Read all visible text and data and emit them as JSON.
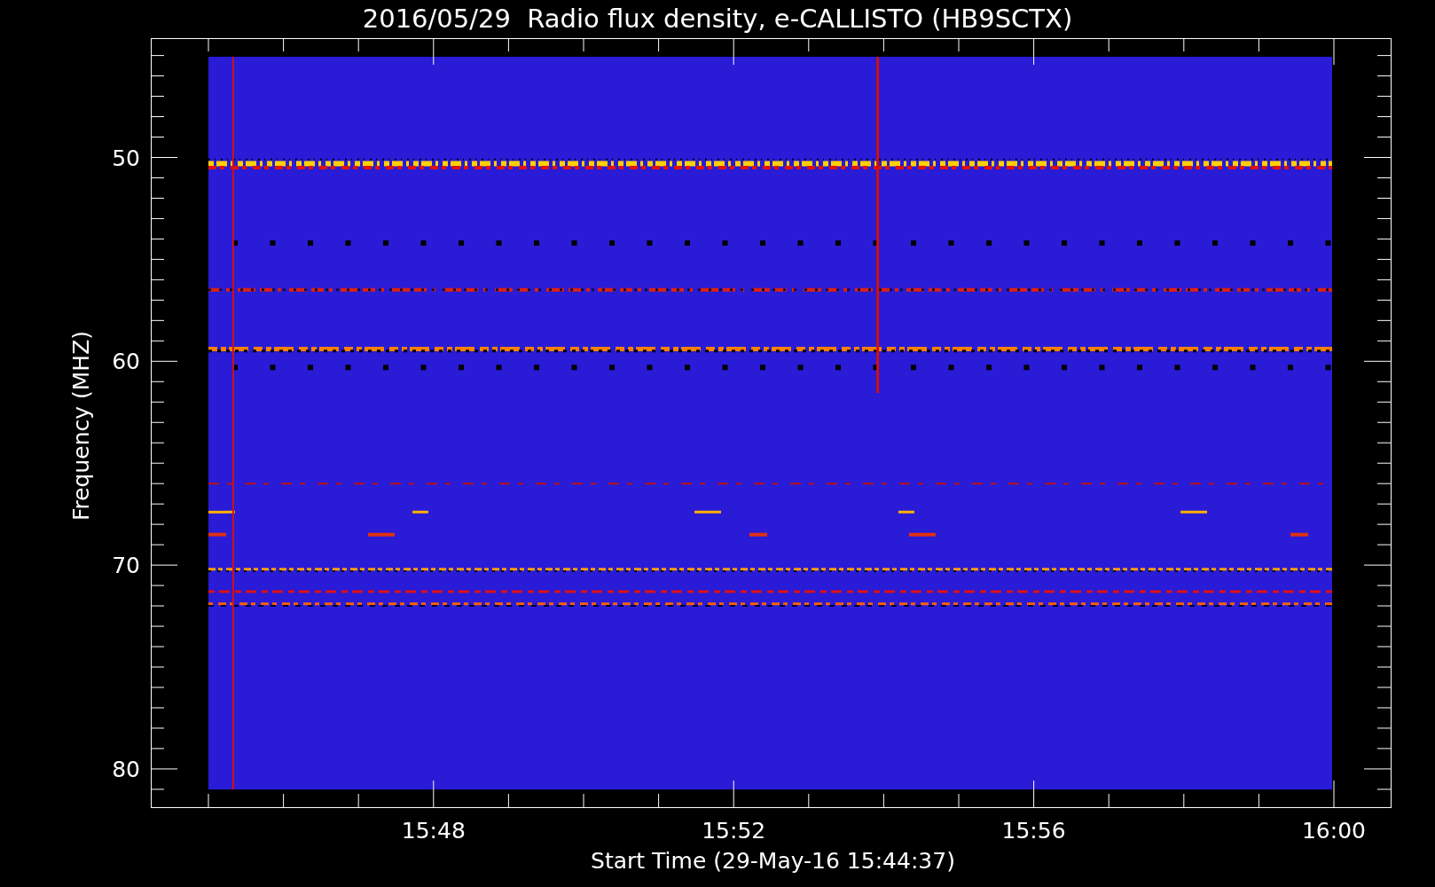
{
  "title": "2016/05/29  Radio flux density, e-CALLISTO (HB9SCTX)",
  "plot": {
    "ylabel": "Frequency (MHZ)",
    "yticks": [
      "50",
      "60",
      "70",
      "80"
    ],
    "xticks": [
      "15:48",
      "15:52",
      "15:56",
      "16:00"
    ],
    "xlabel": "Start Time (29-May-16 15:44:37)"
  }
}
